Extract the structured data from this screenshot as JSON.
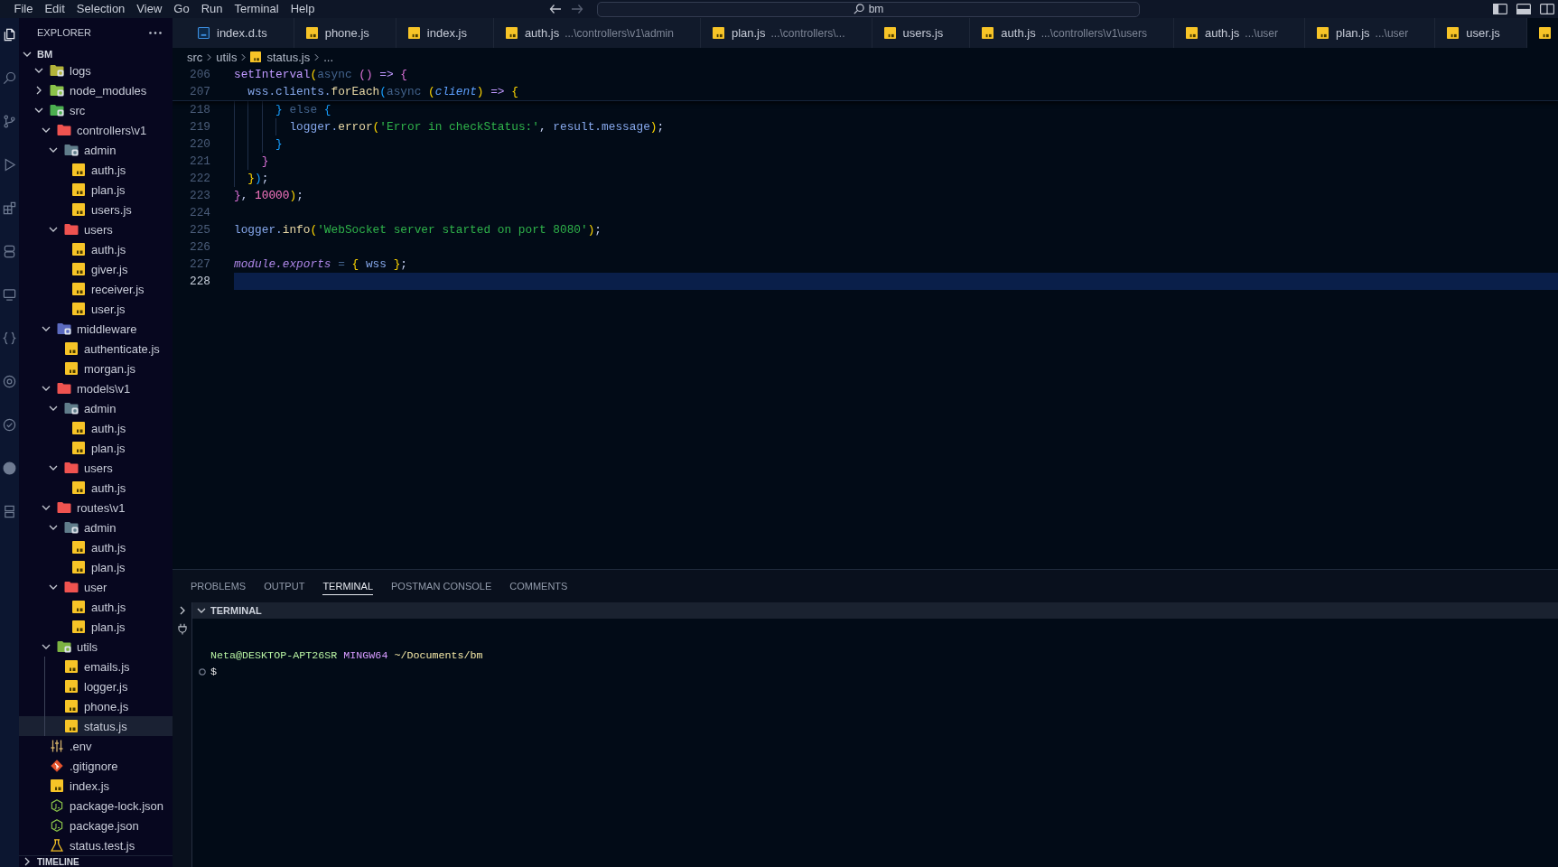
{
  "menu_bar": {
    "items": [
      "File",
      "Edit",
      "Selection",
      "View",
      "Go",
      "Run",
      "Terminal",
      "Help"
    ],
    "navigation": [
      {
        "kind": "back",
        "disabled": false
      },
      {
        "kind": "forward",
        "disabled": true
      }
    ],
    "search": {
      "value": "bm"
    }
  },
  "activity_bar": [
    {
      "kind": "explorer",
      "selected": true
    },
    {
      "kind": "search",
      "selected": false
    },
    {
      "kind": "scm",
      "selected": false
    },
    {
      "kind": "debug",
      "selected": false
    },
    {
      "kind": "extensions",
      "selected": false
    },
    {
      "kind": "stack",
      "selected": false
    },
    {
      "kind": "remote",
      "selected": false
    },
    {
      "kind": "braces",
      "selected": false
    },
    {
      "kind": "ring",
      "selected": false
    },
    {
      "kind": "check",
      "selected": false
    },
    {
      "kind": "disc",
      "selected": false
    },
    {
      "kind": "squares",
      "selected": false
    }
  ],
  "sidebar": {
    "title": "EXPLORER",
    "root": {
      "name": "BM",
      "expanded": true,
      "children": [
        {
          "name": "logs",
          "kind": "folder",
          "color": "#b3b33a",
          "emblem": true,
          "expanded": true,
          "selected": false
        },
        {
          "name": "node_modules",
          "kind": "folder",
          "color": "#8bc34a",
          "emblem": true,
          "expanded": false,
          "selected": false
        },
        {
          "name": "src",
          "kind": "folder",
          "color": "#4caf50",
          "emblem": true,
          "expanded": true,
          "selected": false,
          "children": [
            {
              "name": "controllers\\v1",
              "kind": "folder",
              "color": "#ef5350",
              "emblem": false,
              "expanded": true,
              "selected": false,
              "children": [
                {
                  "name": "admin",
                  "kind": "folder",
                  "color": "#607d8b",
                  "emblem": true,
                  "expanded": true,
                  "selected": false,
                  "children": [
                    {
                      "name": "auth.js",
                      "kind": "js",
                      "selected": false
                    },
                    {
                      "name": "plan.js",
                      "kind": "js",
                      "selected": false
                    },
                    {
                      "name": "users.js",
                      "kind": "js",
                      "selected": false
                    }
                  ]
                },
                {
                  "name": "users",
                  "kind": "folder",
                  "color": "#ef5350",
                  "emblem": false,
                  "expanded": true,
                  "selected": false,
                  "children": [
                    {
                      "name": "auth.js",
                      "kind": "js",
                      "selected": false
                    },
                    {
                      "name": "giver.js",
                      "kind": "js",
                      "selected": false
                    },
                    {
                      "name": "receiver.js",
                      "kind": "js",
                      "selected": false
                    },
                    {
                      "name": "user.js",
                      "kind": "js",
                      "selected": false
                    }
                  ]
                }
              ]
            },
            {
              "name": "middleware",
              "kind": "folder",
              "color": "#5c6bc0",
              "emblem": true,
              "expanded": true,
              "selected": false,
              "children": [
                {
                  "name": "authenticate.js",
                  "kind": "js",
                  "selected": false
                },
                {
                  "name": "morgan.js",
                  "kind": "js",
                  "selected": false
                }
              ]
            },
            {
              "name": "models\\v1",
              "kind": "folder",
              "color": "#ef5350",
              "emblem": false,
              "expanded": true,
              "selected": false,
              "children": [
                {
                  "name": "admin",
                  "kind": "folder",
                  "color": "#607d8b",
                  "emblem": true,
                  "expanded": true,
                  "selected": false,
                  "children": [
                    {
                      "name": "auth.js",
                      "kind": "js",
                      "selected": false
                    },
                    {
                      "name": "plan.js",
                      "kind": "js",
                      "selected": false
                    }
                  ]
                },
                {
                  "name": "users",
                  "kind": "folder",
                  "color": "#ef5350",
                  "emblem": false,
                  "expanded": true,
                  "selected": false,
                  "children": [
                    {
                      "name": "auth.js",
                      "kind": "js",
                      "selected": false
                    }
                  ]
                }
              ]
            },
            {
              "name": "routes\\v1",
              "kind": "folder",
              "color": "#ef5350",
              "emblem": false,
              "expanded": true,
              "selected": false,
              "children": [
                {
                  "name": "admin",
                  "kind": "folder",
                  "color": "#607d8b",
                  "emblem": true,
                  "expanded": true,
                  "selected": false,
                  "children": [
                    {
                      "name": "auth.js",
                      "kind": "js",
                      "selected": false
                    },
                    {
                      "name": "plan.js",
                      "kind": "js",
                      "selected": false
                    }
                  ]
                },
                {
                  "name": "user",
                  "kind": "folder",
                  "color": "#ef5350",
                  "emblem": false,
                  "expanded": true,
                  "selected": false,
                  "children": [
                    {
                      "name": "auth.js",
                      "kind": "js",
                      "selected": false
                    },
                    {
                      "name": "plan.js",
                      "kind": "js",
                      "selected": false
                    }
                  ]
                }
              ]
            },
            {
              "name": "utils",
              "kind": "folder",
              "color": "#7cb342",
              "emblem": true,
              "expanded": true,
              "selected": false,
              "children": [
                {
                  "name": "emails.js",
                  "kind": "js",
                  "selected": false
                },
                {
                  "name": "logger.js",
                  "kind": "js",
                  "selected": false
                },
                {
                  "name": "phone.js",
                  "kind": "js",
                  "selected": false
                },
                {
                  "name": "status.js",
                  "kind": "js",
                  "selected": true
                }
              ]
            }
          ]
        },
        {
          "name": ".env",
          "kind": "env",
          "selected": false
        },
        {
          "name": ".gitignore",
          "kind": "git",
          "selected": false
        },
        {
          "name": "index.js",
          "kind": "js",
          "selected": false
        },
        {
          "name": "package-lock.json",
          "kind": "json",
          "selected": false
        },
        {
          "name": "package.json",
          "kind": "json",
          "selected": false
        },
        {
          "name": "status.test.js",
          "kind": "test",
          "selected": false
        }
      ]
    },
    "timeline": {
      "title": "TIMELINE",
      "expanded": false
    }
  },
  "editor": {
    "tabs": [
      {
        "name": "index.d.ts",
        "kind": "ts",
        "selected": false
      },
      {
        "name": "phone.js",
        "kind": "js",
        "selected": false
      },
      {
        "name": "index.js",
        "kind": "js",
        "selected": false
      },
      {
        "name": "auth.js",
        "description": "...\\controllers\\v1\\admin",
        "kind": "js",
        "selected": false
      },
      {
        "name": "plan.js",
        "description": "...\\controllers\\...",
        "kind": "js",
        "selected": false
      },
      {
        "name": "users.js",
        "kind": "js",
        "selected": false
      },
      {
        "name": "auth.js",
        "description": "...\\controllers\\v1\\users",
        "kind": "js",
        "selected": false
      },
      {
        "name": "auth.js",
        "description": "...\\user",
        "kind": "js",
        "selected": false
      },
      {
        "name": "plan.js",
        "description": "...\\user",
        "kind": "js",
        "selected": false
      },
      {
        "name": "user.js",
        "kind": "js",
        "selected": false
      },
      {
        "kind": "js",
        "selected": true
      }
    ],
    "breadcrumb": [
      {
        "text": "src",
        "kind": "folder"
      },
      {
        "text": "utils",
        "kind": "folder"
      },
      {
        "text": "status.js",
        "kind": "js"
      },
      {
        "text": "...",
        "kind": "more"
      }
    ],
    "sticky_lines": [
      {
        "number": "206",
        "current": false,
        "tokens": [
          {
            "text": "setInterval",
            "kind": "builtin"
          },
          {
            "text": "(",
            "kind": "bracket1"
          },
          {
            "text": "async ",
            "kind": "keyword"
          },
          {
            "text": "() ",
            "kind": "bracket2"
          },
          {
            "text": "=> ",
            "kind": "operator"
          },
          {
            "text": "{",
            "kind": "bracket2"
          }
        ]
      },
      {
        "number": "207",
        "current": false,
        "tokens": [
          {
            "text": "  wss.clients.",
            "kind": "variable"
          },
          {
            "text": "forEach",
            "kind": "method"
          },
          {
            "text": "(",
            "kind": "bracket3"
          },
          {
            "text": "async ",
            "kind": "keyword"
          },
          {
            "text": "(",
            "kind": "bracket1"
          },
          {
            "text": "client",
            "kind": "param"
          },
          {
            "text": ")",
            "kind": "bracket1"
          },
          {
            "text": " => ",
            "kind": "operator"
          },
          {
            "text": "{",
            "kind": "bracket1"
          }
        ]
      }
    ],
    "lines": [
      {
        "number": "218",
        "current": false,
        "tokens": [
          {
            "text": "      }",
            "kind": "bracket3"
          },
          {
            "text": " else ",
            "kind": "keyword"
          },
          {
            "text": "{",
            "kind": "bracket3"
          }
        ]
      },
      {
        "number": "219",
        "current": false,
        "tokens": [
          {
            "text": "        logger.",
            "kind": "variable"
          },
          {
            "text": "error",
            "kind": "method"
          },
          {
            "text": "(",
            "kind": "bracket1"
          },
          {
            "text": "'Error in checkStatus:'",
            "kind": "string"
          },
          {
            "text": ", ",
            "kind": "punct"
          },
          {
            "text": "result.message",
            "kind": "variable"
          },
          {
            "text": ")",
            "kind": "bracket1"
          },
          {
            "text": ";",
            "kind": "punct"
          }
        ]
      },
      {
        "number": "220",
        "current": false,
        "tokens": [
          {
            "text": "      }",
            "kind": "bracket3"
          }
        ]
      },
      {
        "number": "221",
        "current": false,
        "tokens": [
          {
            "text": "    }",
            "kind": "bracket2"
          }
        ]
      },
      {
        "number": "222",
        "current": false,
        "tokens": [
          {
            "text": "  }",
            "kind": "bracket1"
          },
          {
            "text": ")",
            "kind": "bracket3"
          },
          {
            "text": ";",
            "kind": "punct"
          }
        ]
      },
      {
        "number": "223",
        "current": false,
        "tokens": [
          {
            "text": "}",
            "kind": "bracket2"
          },
          {
            "text": ", ",
            "kind": "punct"
          },
          {
            "text": "10000",
            "kind": "number"
          },
          {
            "text": ")",
            "kind": "bracket1"
          },
          {
            "text": ";",
            "kind": "punct"
          }
        ]
      },
      {
        "number": "224",
        "current": false
      },
      {
        "number": "225",
        "current": false,
        "tokens": [
          {
            "text": "logger.",
            "kind": "variable"
          },
          {
            "text": "info",
            "kind": "method"
          },
          {
            "text": "(",
            "kind": "bracket1"
          },
          {
            "text": "'WebSocket server started on port 8080'",
            "kind": "string"
          },
          {
            "text": ")",
            "kind": "bracket1"
          },
          {
            "text": ";",
            "kind": "punct"
          }
        ]
      },
      {
        "number": "226",
        "current": false
      },
      {
        "number": "227",
        "current": false,
        "tokens": [
          {
            "text": "module.exports",
            "kind": "module"
          },
          {
            "text": " = ",
            "kind": "assign"
          },
          {
            "text": "{",
            "kind": "bracket1"
          },
          {
            "text": " wss ",
            "kind": "variable"
          },
          {
            "text": "}",
            "kind": "bracket1"
          },
          {
            "text": ";",
            "kind": "punct"
          }
        ]
      },
      {
        "number": "228",
        "current": true
      }
    ]
  },
  "panel": {
    "tabs": [
      {
        "label": "PROBLEMS",
        "selected": false
      },
      {
        "label": "OUTPUT",
        "selected": false
      },
      {
        "label": "TERMINAL",
        "selected": true
      },
      {
        "label": "POSTMAN CONSOLE",
        "selected": false
      },
      {
        "label": "COMMENTS",
        "selected": false
      }
    ],
    "section": {
      "title": "TERMINAL",
      "expanded": true
    },
    "terminal": [
      {
        "decoration": false,
        "tokens": [
          {
            "text": "Neta@DESKTOP-APT26SR",
            "kind": "user"
          },
          {
            "text": " MINGW64",
            "kind": "system"
          },
          {
            "text": " ~/Documents/bm",
            "kind": "path"
          }
        ]
      },
      {
        "decoration": true,
        "tokens": [
          {
            "text": "$",
            "kind": "prompt"
          }
        ]
      }
    ]
  }
}
